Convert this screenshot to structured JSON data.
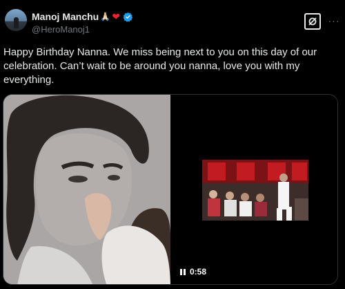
{
  "author": {
    "name": "Manoj Manchu",
    "name_emojis": "🙏🏻",
    "heart": "❤",
    "handle": "@HeroManoj1",
    "verified": true
  },
  "icons": {
    "avatar": "profile-photo",
    "grok": "grok-icon",
    "more": "more-icon",
    "verified": "verified-badge-icon",
    "pause": "pause-icon"
  },
  "tweet": {
    "text": "Happy Birthday Nanna. We miss being next to you on this day of our\ncelebration. Can’t wait to be around you nanna, love you with my\neverything."
  },
  "media": {
    "video_duration": "0:58"
  },
  "colors": {
    "background": "#000000",
    "text": "#e7e9ea",
    "secondary_text": "#71767b",
    "verified_blue": "#1d9bf0",
    "heart_red": "#f4212e"
  }
}
